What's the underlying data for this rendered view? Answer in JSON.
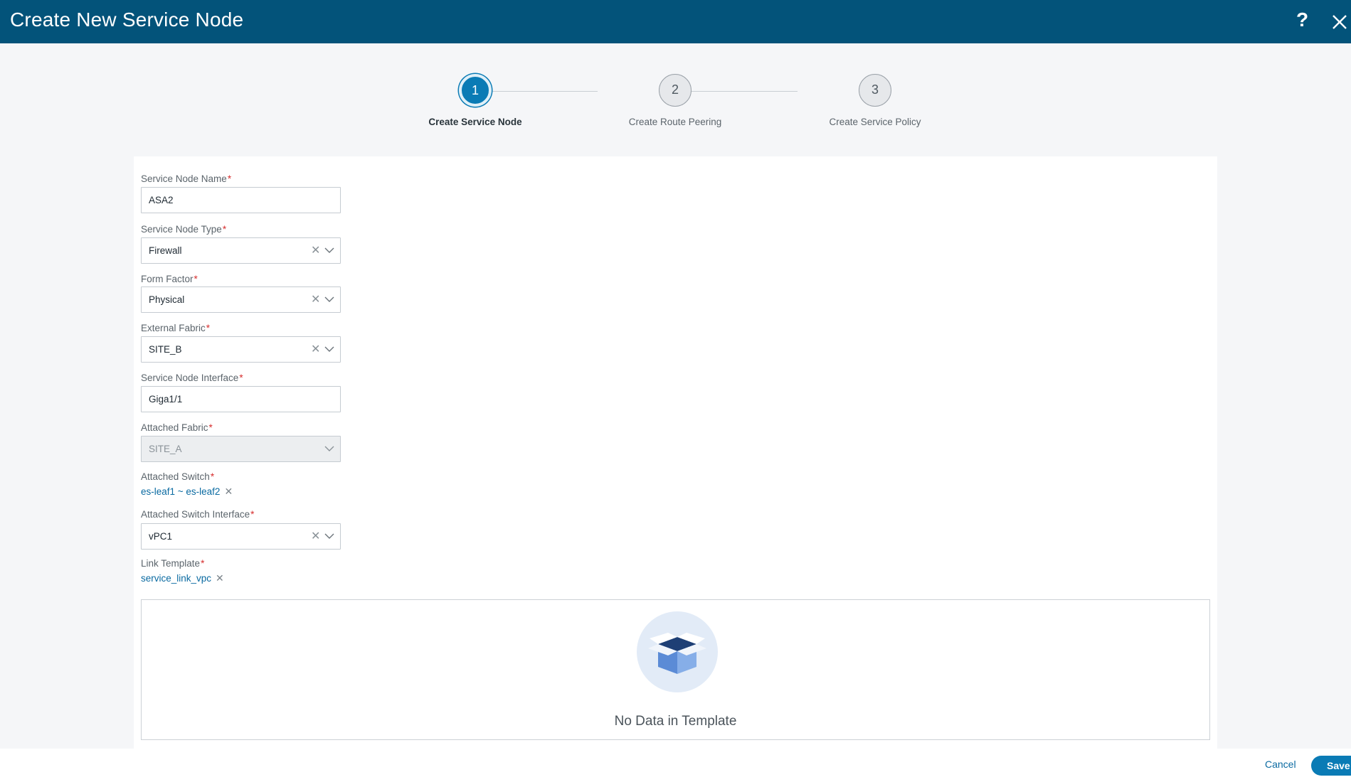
{
  "header": {
    "title": "Create New Service Node",
    "help_glyph": "?"
  },
  "steps": [
    {
      "number": "1",
      "label": "Create Service Node",
      "active": true
    },
    {
      "number": "2",
      "label": "Create Route Peering",
      "active": false
    },
    {
      "number": "3",
      "label": "Create Service Policy",
      "active": false
    }
  ],
  "form": {
    "required_mark": "*",
    "service_node_name": {
      "label": "Service Node Name",
      "value": "ASA2"
    },
    "service_node_type": {
      "label": "Service Node Type",
      "value": "Firewall"
    },
    "form_factor": {
      "label": "Form Factor",
      "value": "Physical"
    },
    "external_fabric": {
      "label": "External Fabric",
      "value": "SITE_B"
    },
    "service_node_interface": {
      "label": "Service Node Interface",
      "value": "Giga1/1"
    },
    "attached_fabric": {
      "label": "Attached Fabric",
      "value": "SITE_A"
    },
    "attached_switch": {
      "label": "Attached Switch",
      "value": "es-leaf1 ~ es-leaf2"
    },
    "attached_switch_interface": {
      "label": "Attached Switch Interface",
      "value": "vPC1"
    },
    "link_template": {
      "label": "Link Template",
      "value": "service_link_vpc"
    }
  },
  "template_panel": {
    "empty_text": "No Data in Template"
  },
  "footer": {
    "cancel_label": "Cancel",
    "save_label": "Save"
  },
  "colors": {
    "header_bg": "#03537a",
    "accent": "#0a7bb5",
    "required": "#d62d2d",
    "link": "#0a6aa1"
  }
}
